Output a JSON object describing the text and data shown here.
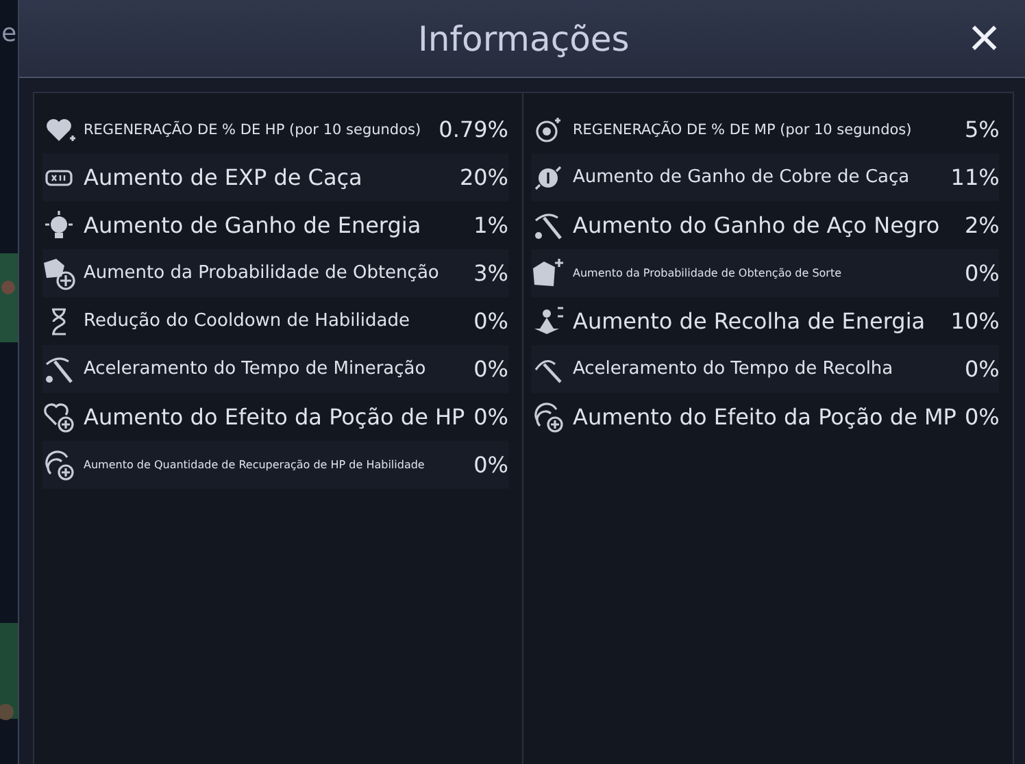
{
  "backdrop_text": "e",
  "window": {
    "title": "Informações",
    "close": "×"
  },
  "columns": [
    {
      "rows": [
        {
          "kind": "caption",
          "label": "REGENERAÇÃO DE % DE HP (por 10 segundos)",
          "value": "0.79%"
        },
        {
          "kind": "headline",
          "label": "Aumento de EXP de Caça",
          "value": "20%"
        },
        {
          "kind": "headline",
          "label": "Aumento de Ganho de Energia",
          "value": "1%"
        },
        {
          "kind": "label",
          "label": "Aumento da Probabilidade de Obtenção",
          "value": "3%"
        },
        {
          "kind": "label",
          "label": "Redução do Cooldown de Habilidade",
          "value": "0%"
        },
        {
          "kind": "label",
          "label": "Aceleramento do Tempo de Mineração",
          "value": "0%"
        },
        {
          "kind": "headline",
          "label": "Aumento do Efeito da Poção de HP",
          "value": "0%"
        },
        {
          "kind": "fine",
          "label": "Aumento de Quantidade de Recuperação de HP de Habilidade",
          "value": "0%"
        }
      ]
    },
    {
      "rows": [
        {
          "kind": "caption",
          "label": "REGENERAÇÃO DE % DE MP (por 10 segundos)",
          "value": "5%"
        },
        {
          "kind": "label",
          "label": "Aumento de Ganho de Cobre de Caça",
          "value": "11%"
        },
        {
          "kind": "headline",
          "label": "Aumento do Ganho de Aço Negro",
          "value": "2%"
        },
        {
          "kind": "fine",
          "label": "Aumento da Probabilidade de Obtenção de Sorte",
          "value": "0%"
        },
        {
          "kind": "headline",
          "label": "Aumento de Recolha de Energia",
          "value": "10%"
        },
        {
          "kind": "label",
          "label": "Aceleramento do Tempo de Recolha",
          "value": "0%"
        },
        {
          "kind": "headline",
          "label": "Aumento do Efeito da Poção de MP",
          "value": "0%"
        }
      ]
    }
  ]
}
